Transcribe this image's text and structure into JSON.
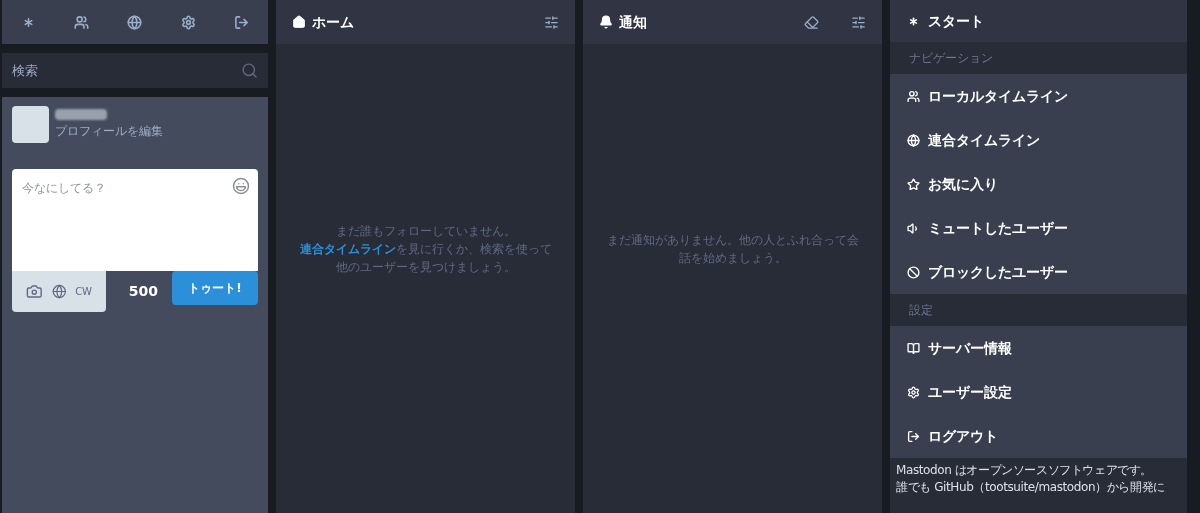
{
  "top_nav": [
    {
      "kind": "start"
    },
    {
      "kind": "local"
    },
    {
      "kind": "federated"
    },
    {
      "kind": "settings"
    },
    {
      "kind": "logout"
    }
  ],
  "search": {
    "placeholder": "検索"
  },
  "profile": {
    "edit_link": "プロフィールを編集"
  },
  "compose": {
    "placeholder": "今なにしてる？",
    "cw": "CW",
    "counter": "500",
    "submit": "トゥート!"
  },
  "columns": [
    {
      "kind": "home",
      "title": "ホーム",
      "empty_text": "まだ誰もフォローしていません。",
      "link": "連合タイムライン",
      "empty_rest": "を見に行くか、検索を使って他のユーザーを見つけましょう。"
    },
    {
      "kind": "notifications",
      "title": "通知",
      "empty_text": "まだ通知がありません。他の人とふれ合って会話を始めましょう。"
    }
  ],
  "start": {
    "title": "スタート"
  },
  "sections": [
    {
      "heading": "ナビゲーション",
      "items": [
        {
          "kind": "users",
          "label": "ローカルタイムライン"
        },
        {
          "kind": "globe",
          "label": "連合タイムライン"
        },
        {
          "kind": "star",
          "label": "お気に入り"
        },
        {
          "kind": "mute",
          "label": "ミュートしたユーザー"
        },
        {
          "kind": "block",
          "label": "ブロックしたユーザー"
        }
      ]
    },
    {
      "heading": "設定",
      "items": [
        {
          "kind": "book",
          "label": "サーバー情報"
        },
        {
          "kind": "gear",
          "label": "ユーザー設定"
        },
        {
          "kind": "logout",
          "label": "ログアウト"
        }
      ]
    }
  ],
  "about": {
    "lines": [
      "Mastodon はオープンソースソフトウェアです。",
      "誰でも GitHub（tootsuite/mastodon）から開発に"
    ]
  }
}
